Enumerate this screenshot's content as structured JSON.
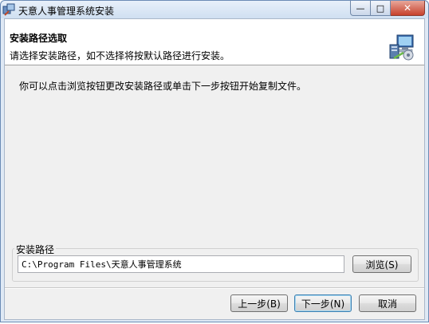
{
  "window": {
    "title": "天意人事管理系统安装",
    "icons": {
      "app": "installer-app-icon",
      "minimize": "minimize-icon",
      "maximize": "maximize-icon",
      "close": "close-icon"
    },
    "captions": {
      "minimize": "—",
      "maximize": "□",
      "close": "✕"
    }
  },
  "banner": {
    "title": "安装路径选取",
    "subtitle": "请选择安装路径，如不选择将按默认路径进行安装。",
    "icon": "setup-computer-icon"
  },
  "instruction": "你可以点击浏览按钮更改安装路径或单击下一步按钮开始复制文件。",
  "install_path": {
    "group_label": "安装路径",
    "value": "C:\\Program Files\\天意人事管理系统",
    "browse_label": "浏览(S)"
  },
  "footer": {
    "back_label": "上一步(B)",
    "next_label": "下一步(N)",
    "cancel_label": "取消"
  },
  "colors": {
    "titlebar": "#cfdff1",
    "banner_bg": "#ffffff",
    "client_bg": "#f0f0f0",
    "close_button": "#c7412d"
  }
}
